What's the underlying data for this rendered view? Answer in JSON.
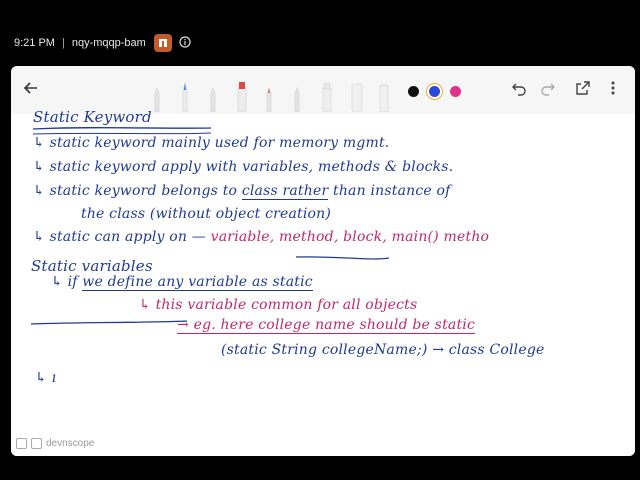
{
  "status_bar": {
    "time": "9:21 PM",
    "separator": "|",
    "meeting_code": "nqy-mqqp-bam"
  },
  "toolbar": {
    "back_icon": "arrow-left-icon",
    "colors": {
      "black": "#111111",
      "blue": "#2a4bd7",
      "pink": "#e0338a"
    },
    "undo_icon": "undo-icon",
    "redo_icon": "redo-icon",
    "export_icon": "export-icon",
    "more_icon": "more-vertical-icon"
  },
  "notes": {
    "heading1": "Static Keyword",
    "line1": "↳ static keyword mainly used for memory mgmt.",
    "line2": "↳ static keyword apply with variables, methods & blocks.",
    "line3a": "↳ static keyword belongs to ",
    "line3b": "class rather",
    "line3c": " than instance of",
    "line4": "the class (without object creation)",
    "line5a": "↳ static can apply on —",
    "line5b": "variable, method, block, main() metho",
    "heading2": "Static variables",
    "line6a": "↳ if ",
    "line6b": "we define any variable as static",
    "line7": "↳ this variable common for all objects",
    "line8a": "→ eg.",
    "line8b": " here college name should be static",
    "line9a": "(static String collegeName;)",
    "line9b": "→ class College",
    "line10": "↳ ı"
  },
  "watermark": {
    "text": "devnscope"
  }
}
